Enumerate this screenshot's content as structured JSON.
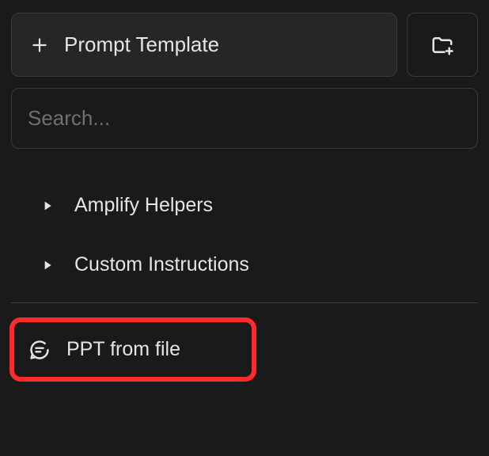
{
  "toolbar": {
    "prompt_template_label": "Prompt Template"
  },
  "search": {
    "placeholder": "Search...",
    "value": ""
  },
  "folders": [
    {
      "label": "Amplify Helpers"
    },
    {
      "label": "Custom Instructions"
    }
  ],
  "templates": [
    {
      "label": "PPT from file"
    }
  ]
}
